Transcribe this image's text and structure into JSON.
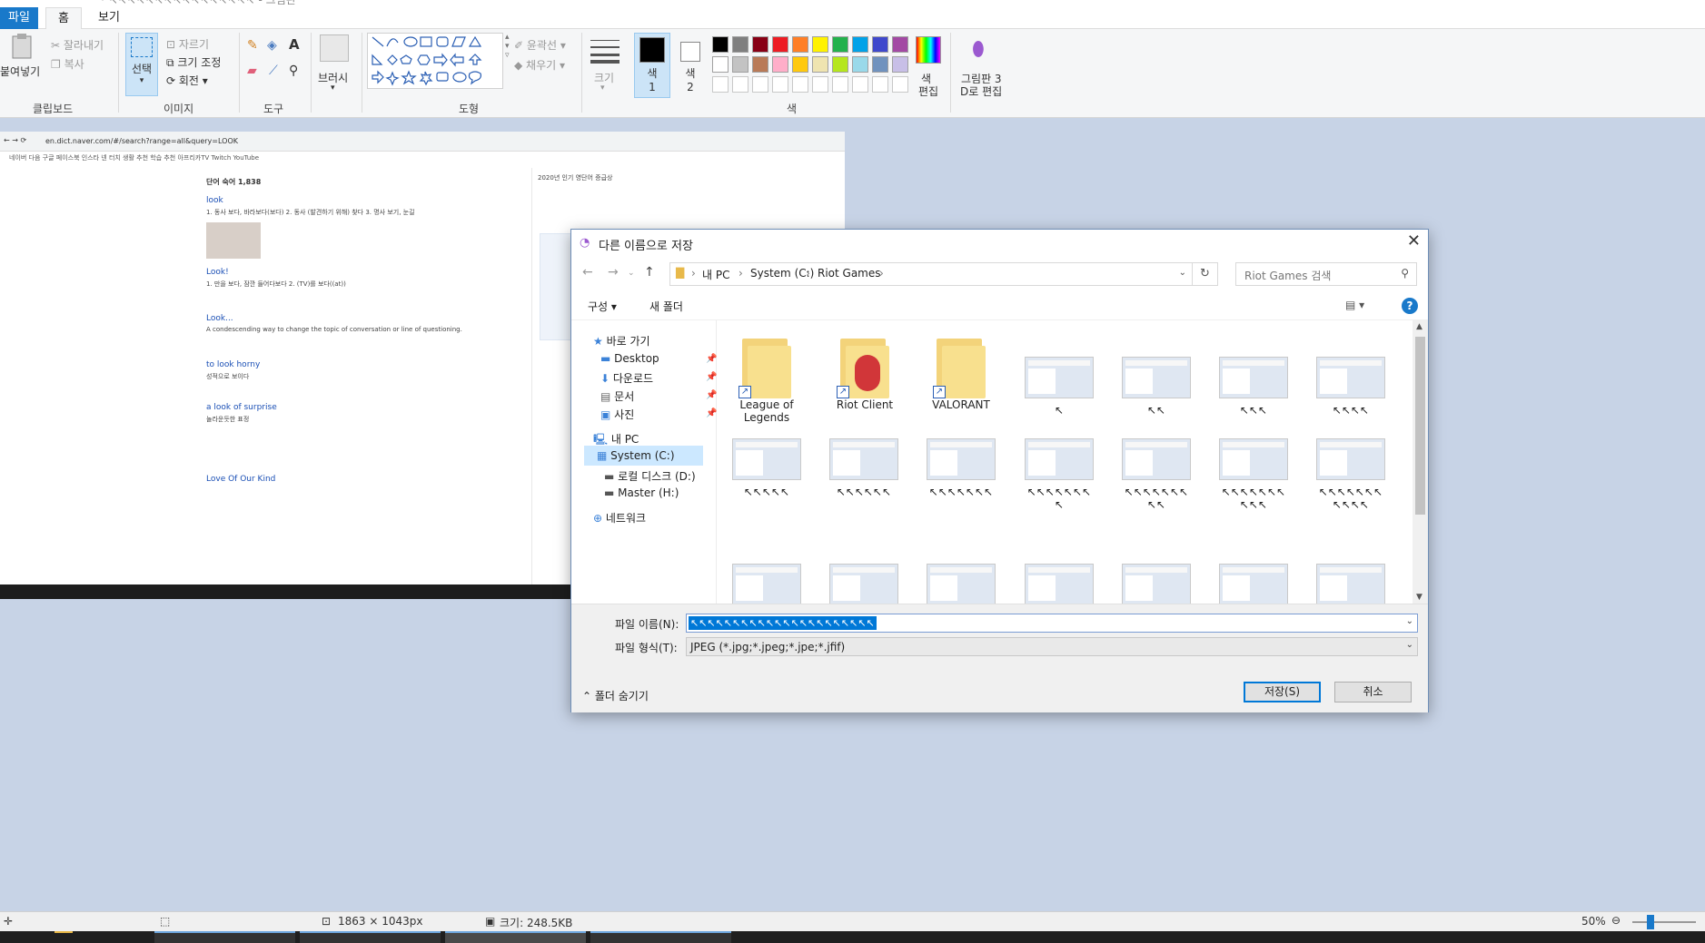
{
  "window": {
    "title": "* ↖↖↖↖↖↖↖↖↖↖↖↖↖↖↖↖ - 그림판"
  },
  "tabs": {
    "file": "파일",
    "home": "홈",
    "view": "보기"
  },
  "ribbon": {
    "clipboard": {
      "paste": "붙여넣기",
      "cut": "잘라내기",
      "copy": "복사",
      "label": "클립보드"
    },
    "image": {
      "select": "선택",
      "crop": "자르기",
      "resize": "크기 조정",
      "rotate": "회전",
      "label": "이미지"
    },
    "tools": {
      "label": "도구"
    },
    "brush": {
      "label": "브러시"
    },
    "shapes": {
      "outline": "윤곽선",
      "fill": "채우기",
      "label": "도형"
    },
    "size": {
      "label": "크기"
    },
    "color1": "색\n1",
    "color1_a": "색",
    "color1_b": "1",
    "color2_a": "색",
    "color2_b": "2",
    "colors_label": "색",
    "edit_colors_a": "색",
    "edit_colors_b": "편집",
    "paint3d_a": "그림판 3",
    "paint3d_b": "D로 편집",
    "palette_row1": [
      "#000000",
      "#7f7f7f",
      "#880015",
      "#ed1c24",
      "#ff7f27",
      "#fff200",
      "#22b14c",
      "#00a2e8",
      "#3f48cc",
      "#a349a4"
    ],
    "palette_row2": [
      "#ffffff",
      "#c3c3c3",
      "#b97a57",
      "#ffaec9",
      "#ffc90e",
      "#efe4b0",
      "#b5e61d",
      "#99d9ea",
      "#7092be",
      "#c8bfe7"
    ]
  },
  "screenshot": {
    "url": "en.dict.naver.com/#/search?range=all&query=LOOK",
    "bookmarks": "네이버   다음   구글   페이스북   인스타   넨 터치   생활 추천   학습 추천   아프리카TV   Twitch   YouTube",
    "section": "단어 숙어 1,838",
    "entries": [
      {
        "word": "look",
        "line": "1. 동사 보다, 바라보다(보다)   2. 동사 (발견하기 위해) 찾다   3. 명사 보기, 눈길"
      },
      {
        "word": "Look!",
        "line": "1. 만을 보다, 잠깐 들어다보다   2. (TV)를 보다((at))"
      },
      {
        "word": "Look...",
        "line": "A condescending way to change the topic of conversation or line of questioning."
      },
      {
        "word": "to look horny",
        "line": "성적으로 보이다"
      },
      {
        "word": "a look of surprise",
        "line": "놀라운듯한 표정"
      },
      {
        "word": "Love Of Our Kind",
        "line": ""
      }
    ],
    "right_note": "2020년 인기 영단어 증급상"
  },
  "dialog": {
    "title": "다른 이름으로 저장",
    "breadcrumb": [
      "내 PC",
      "System (C:)",
      "Riot Games"
    ],
    "search_placeholder": "Riot Games 검색",
    "organize": "구성",
    "new_folder": "새 폴더",
    "nav": {
      "quick": "바로 가기",
      "desktop": "Desktop",
      "downloads": "다운로드",
      "documents": "문서",
      "pictures": "사진",
      "mypc": "내 PC",
      "c": "System (C:)",
      "d": "로컬 디스크 (D:)",
      "h": "Master (H:)",
      "network": "네트워크"
    },
    "folders": [
      "League of Legends",
      "Riot Client",
      "VALORANT"
    ],
    "row1_files": [
      "↖",
      "↖↖",
      "↖↖↖",
      "↖↖↖↖"
    ],
    "row2_files": [
      "↖↖↖↖↖",
      "↖↖↖↖↖↖",
      "↖↖↖↖↖↖↖",
      "↖↖↖↖↖↖↖↖",
      "↖↖↖↖↖↖↖↖↖",
      "↖↖↖↖↖↖↖↖↖↖",
      "↖↖↖↖↖↖↖↖↖↖↖"
    ],
    "filename_label": "파일 이름(N):",
    "filename_value": "↖↖↖↖↖↖↖↖↖↖↖↖↖↖↖↖↖↖↖↖↖↖",
    "filetype_label": "파일 형식(T):",
    "filetype_value": "JPEG (*.jpg;*.jpeg;*.jpe;*.jfif)",
    "hide_folders": "폴더 숨기기",
    "save": "저장(S)",
    "cancel": "취소"
  },
  "status": {
    "dimensions": "1863 × 1043px",
    "size": "크기: 248.5KB",
    "zoom": "50%"
  }
}
